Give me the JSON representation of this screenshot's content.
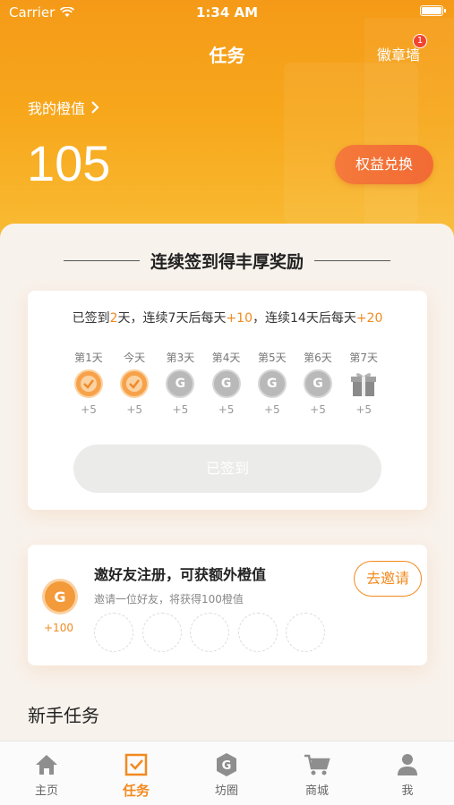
{
  "status_bar": {
    "carrier": "Carrier",
    "time": "1:34 AM"
  },
  "header": {
    "title": "任务",
    "badge_wall_label": "徽章墙",
    "badge_count": "1",
    "my_value_label": "我的橙值",
    "value": "105",
    "redeem_label": "权益兑换"
  },
  "signin": {
    "heading": "连续签到得丰厚奖励",
    "desc_parts": [
      "已签到",
      "2",
      "天，连续7天后每天",
      "+10",
      "，连续14天后每天",
      "+20"
    ],
    "days": [
      {
        "label": "第1天",
        "reward": "+5",
        "state": "done"
      },
      {
        "label": "今天",
        "reward": "+5",
        "state": "done"
      },
      {
        "label": "第3天",
        "reward": "+5",
        "state": "todo"
      },
      {
        "label": "第4天",
        "reward": "+5",
        "state": "todo"
      },
      {
        "label": "第5天",
        "reward": "+5",
        "state": "todo"
      },
      {
        "label": "第6天",
        "reward": "+5",
        "state": "todo"
      },
      {
        "label": "第7天",
        "reward": "+5",
        "state": "gift"
      }
    ],
    "button_label": "已签到"
  },
  "invite": {
    "title": "邀好友注册，可获额外橙值",
    "subtitle": "邀请一位好友，将获得100橙值",
    "reward": "+100",
    "button_label": "去邀请",
    "slot_count": 5
  },
  "newbie": {
    "title": "新手任务"
  },
  "tabbar": {
    "items": [
      {
        "label": "主页",
        "icon": "home-icon",
        "active": false
      },
      {
        "label": "任务",
        "icon": "task-icon",
        "active": true
      },
      {
        "label": "坊圈",
        "icon": "circle-icon",
        "active": false
      },
      {
        "label": "商城",
        "icon": "cart-icon",
        "active": false
      },
      {
        "label": "我",
        "icon": "user-icon",
        "active": false
      }
    ]
  },
  "colors": {
    "accent": "#f28a1e",
    "hero_top": "#f59a18",
    "hero_bottom": "#f9c03a"
  }
}
